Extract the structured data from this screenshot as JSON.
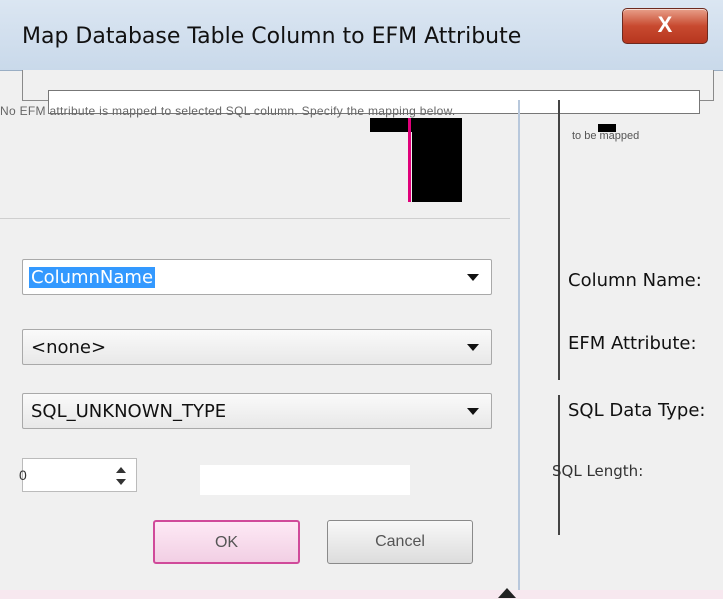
{
  "window": {
    "title": "Map Database Table Column to EFM Attribute",
    "close_glyph": "X"
  },
  "message": {
    "text": "No EFM attribute is mapped to selected SQL column. Specify the mapping below.",
    "text2": "to be mapped"
  },
  "fields": {
    "column_name": {
      "label": "Column Name:",
      "value": "ColumnName"
    },
    "efm_attribute": {
      "label": "EFM Attribute:",
      "value": "<none>"
    },
    "sql_data_type": {
      "label": "SQL Data Type:",
      "value": "SQL_UNKNOWN_TYPE"
    },
    "sql_length": {
      "label": "SQL Length:",
      "value": "0"
    }
  },
  "buttons": {
    "ok": "OK",
    "cancel": "Cancel"
  },
  "colors": {
    "selection": "#3399ff",
    "close": "#c84a30",
    "ok_border": "#d04a9a"
  }
}
